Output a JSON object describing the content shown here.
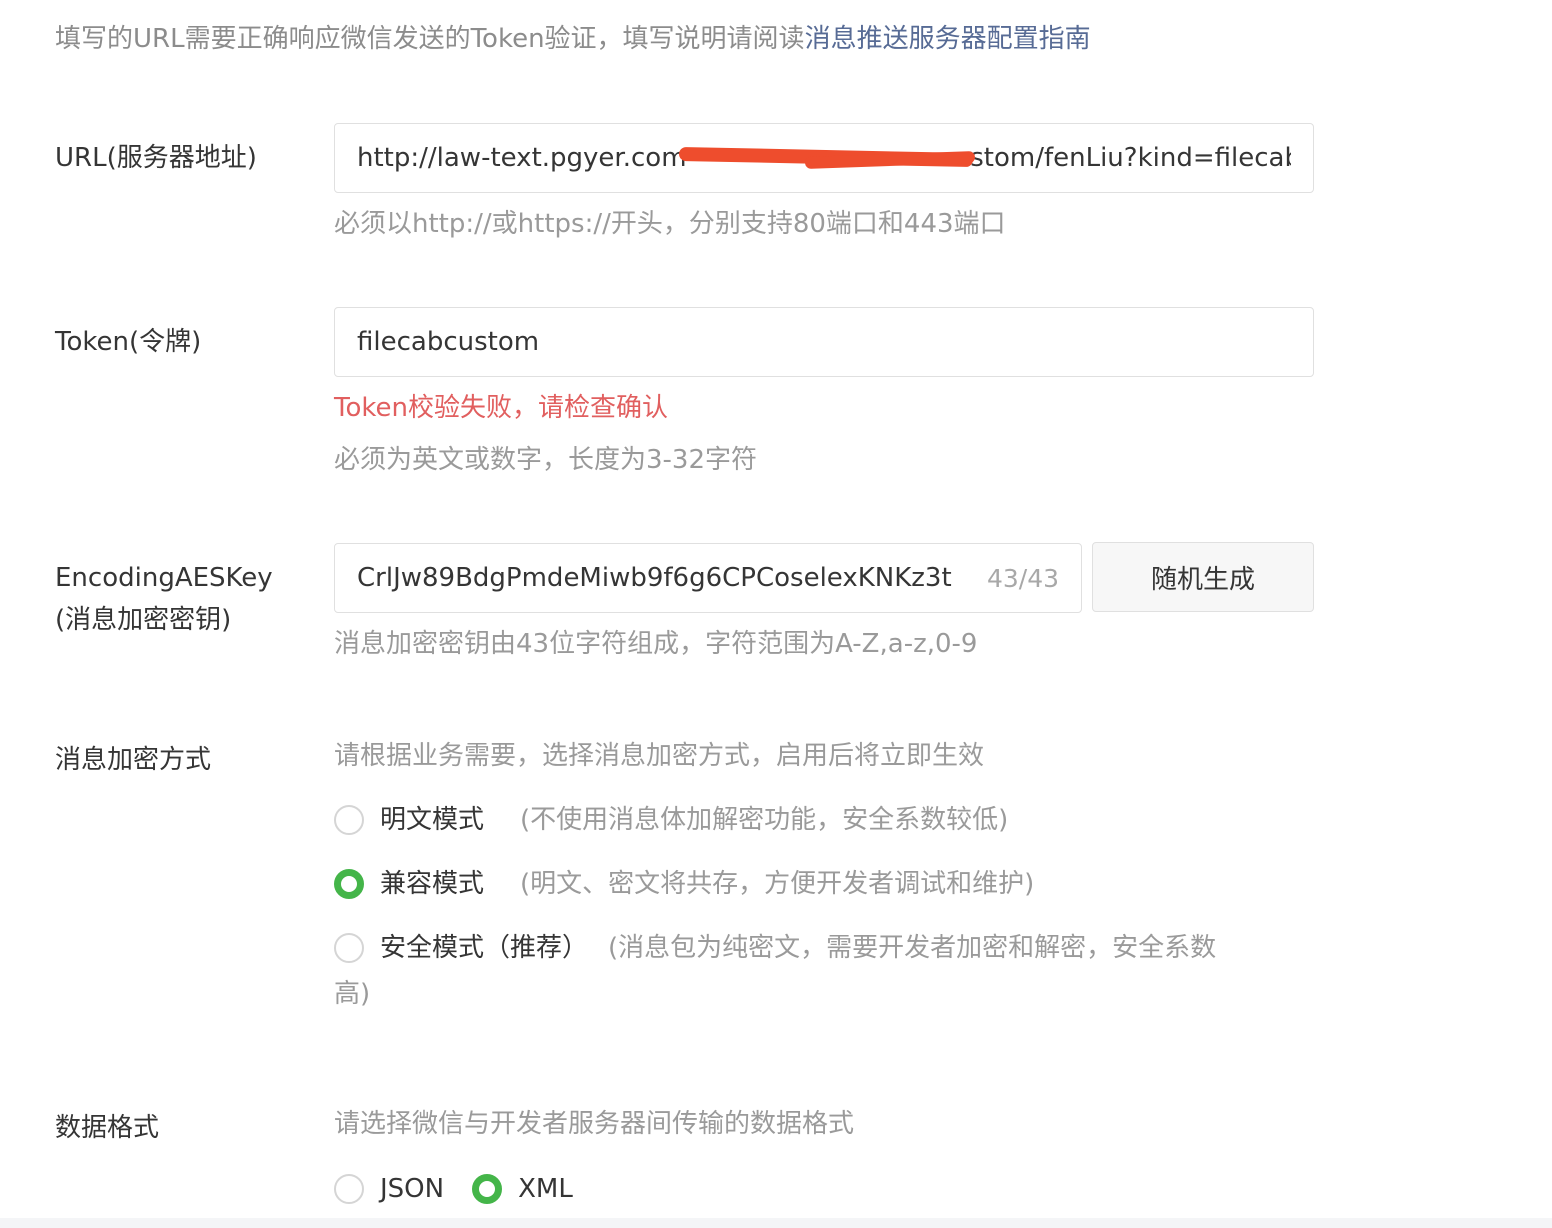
{
  "intro": {
    "text": "填写的URL需要正确响应微信发送的Token验证，填写说明请阅读",
    "link": "消息推送服务器配置指南"
  },
  "url": {
    "label": "URL(服务器地址)",
    "value": "http://law-text.pgyer.com/publicus…/fenLiu/customstom/fenLiu?kind=filecab",
    "value_prefix": "http://law-text.pgyer.com/",
    "value_suffix": "stom/fenLiu?kind=filecab",
    "hint": "必须以http://或https://开头，分别支持80端口和443端口"
  },
  "token": {
    "label": "Token(令牌)",
    "value": "filecabcustom",
    "error": "Token校验失败，请检查确认",
    "hint": "必须为英文或数字，长度为3-32字符"
  },
  "aes": {
    "label_line1": "EncodingAESKey",
    "label_line2": "(消息加密密钥)",
    "value": "CrlJw89BdgPmdeMiwb9f6g6CPCoselexKNKz3t",
    "counter": "43/43",
    "button": "随机生成",
    "hint": "消息加密密钥由43位字符组成，字符范围为A-Z,a-z,0-9"
  },
  "encrypt": {
    "label": "消息加密方式",
    "hint": "请根据业务需要，选择消息加密方式，启用后将立即生效",
    "options": [
      {
        "label": "明文模式",
        "desc": "(不使用消息体加解密功能，安全系数较低)",
        "checked": false
      },
      {
        "label": "兼容模式",
        "desc": "(明文、密文将共存，方便开发者调试和维护)",
        "checked": true
      },
      {
        "label": "安全模式（推荐）",
        "desc": "(消息包为纯密文，需要开发者加密和解密，安全系数",
        "desc_wrap": "高)",
        "checked": false
      }
    ]
  },
  "format": {
    "label": "数据格式",
    "hint": "请选择微信与开发者服务器间传输的数据格式",
    "options": [
      {
        "label": "JSON",
        "checked": false
      },
      {
        "label": "XML",
        "checked": true
      }
    ]
  },
  "colors": {
    "accent_green": "#44b549",
    "link_blue": "#576b95",
    "error_red": "#e15f5f",
    "redaction": "#ee4d2d"
  }
}
